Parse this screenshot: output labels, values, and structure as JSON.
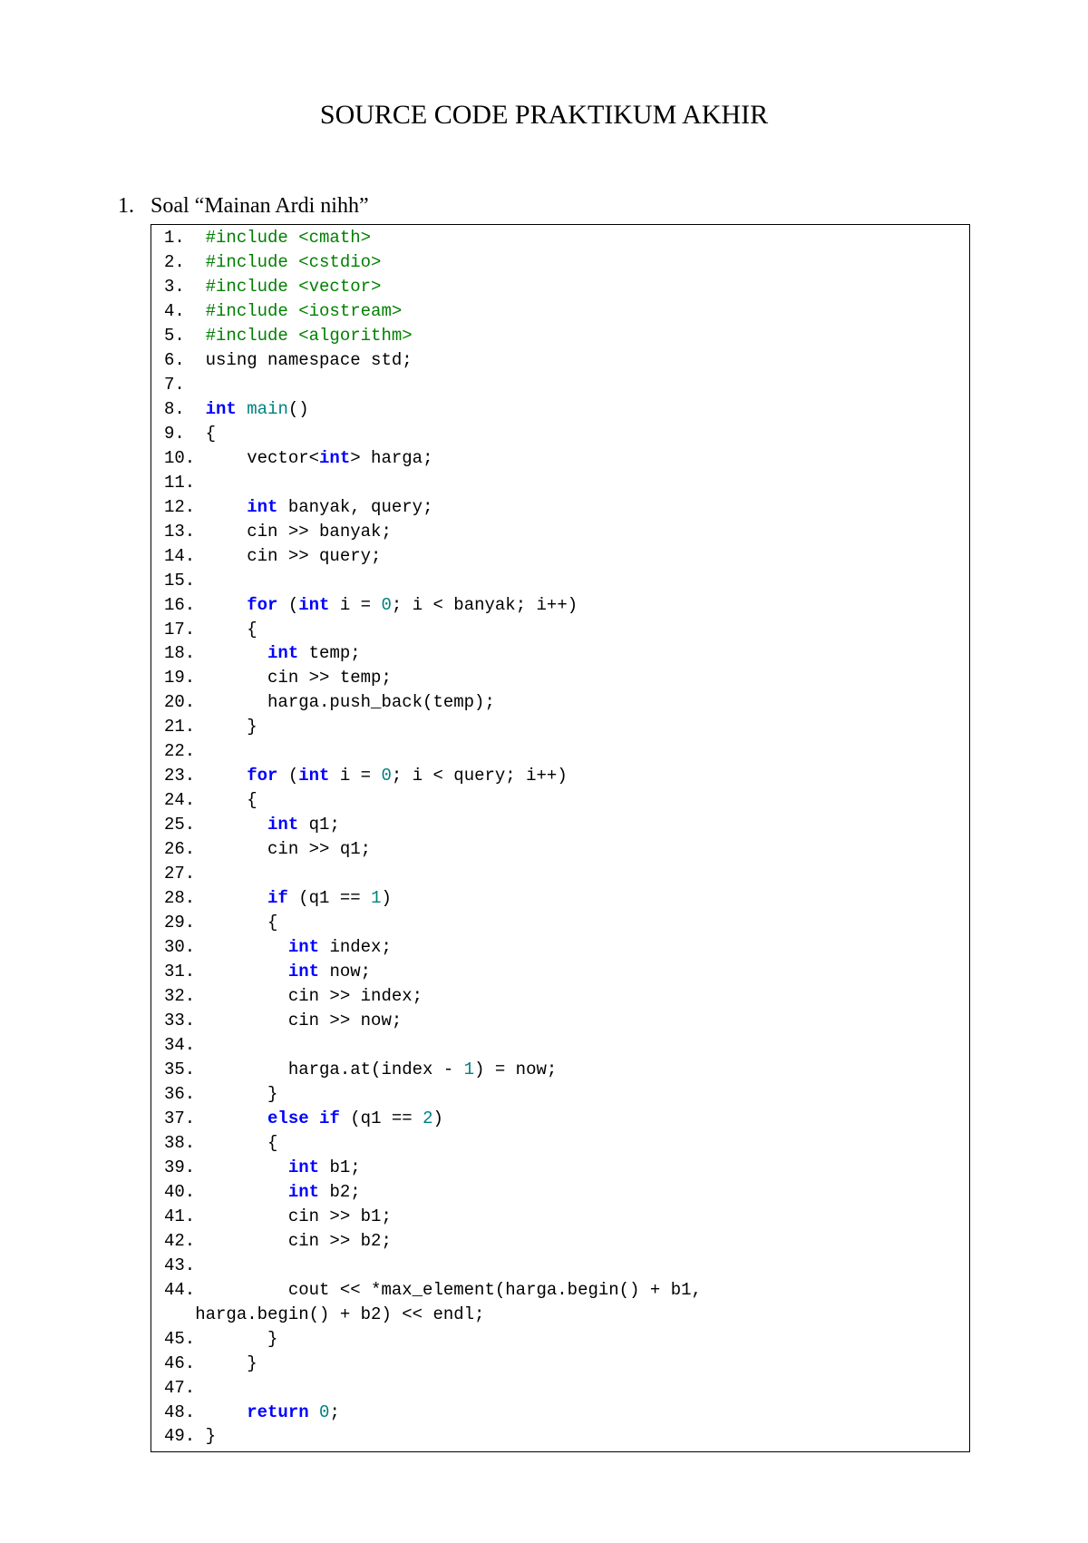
{
  "title": "SOURCE CODE PRAKTIKUM AKHIR",
  "section": {
    "number": "1.",
    "label": "Soal “Mainan Ardi nihh”"
  },
  "code": {
    "lines": [
      {
        "n": "1.",
        "tokens": [
          {
            "t": "pp",
            "v": "#include <cmath>"
          }
        ]
      },
      {
        "n": "2.",
        "tokens": [
          {
            "t": "pp",
            "v": "#include <cstdio>"
          }
        ]
      },
      {
        "n": "3.",
        "tokens": [
          {
            "t": "pp",
            "v": "#include <vector>"
          }
        ]
      },
      {
        "n": "4.",
        "tokens": [
          {
            "t": "pp",
            "v": "#include <iostream>"
          }
        ]
      },
      {
        "n": "5.",
        "tokens": [
          {
            "t": "pp",
            "v": "#include <algorithm>"
          }
        ]
      },
      {
        "n": "6.",
        "tokens": [
          {
            "t": "",
            "v": "using namespace std;"
          }
        ]
      },
      {
        "n": "7.",
        "tokens": []
      },
      {
        "n": "8.",
        "tokens": [
          {
            "t": "kw",
            "v": "int"
          },
          {
            "t": "",
            "v": " "
          },
          {
            "t": "fn",
            "v": "main"
          },
          {
            "t": "",
            "v": "()"
          }
        ]
      },
      {
        "n": "9.",
        "tokens": [
          {
            "t": "",
            "v": "{"
          }
        ]
      },
      {
        "n": "10.",
        "tokens": [
          {
            "t": "",
            "v": "    vector<"
          },
          {
            "t": "kw",
            "v": "int"
          },
          {
            "t": "",
            "v": "> harga;"
          }
        ]
      },
      {
        "n": "11.",
        "tokens": []
      },
      {
        "n": "12.",
        "tokens": [
          {
            "t": "",
            "v": "    "
          },
          {
            "t": "kw",
            "v": "int"
          },
          {
            "t": "",
            "v": " banyak, query;"
          }
        ]
      },
      {
        "n": "13.",
        "tokens": [
          {
            "t": "",
            "v": "    cin >> banyak;"
          }
        ]
      },
      {
        "n": "14.",
        "tokens": [
          {
            "t": "",
            "v": "    cin >> query;"
          }
        ]
      },
      {
        "n": "15.",
        "tokens": []
      },
      {
        "n": "16.",
        "tokens": [
          {
            "t": "",
            "v": "    "
          },
          {
            "t": "kw",
            "v": "for"
          },
          {
            "t": "",
            "v": " ("
          },
          {
            "t": "kw",
            "v": "int"
          },
          {
            "t": "",
            "v": " i = "
          },
          {
            "t": "num",
            "v": "0"
          },
          {
            "t": "",
            "v": "; i < banyak; i++)"
          }
        ]
      },
      {
        "n": "17.",
        "tokens": [
          {
            "t": "",
            "v": "    {"
          }
        ]
      },
      {
        "n": "18.",
        "tokens": [
          {
            "t": "",
            "v": "      "
          },
          {
            "t": "kw",
            "v": "int"
          },
          {
            "t": "",
            "v": " temp;"
          }
        ]
      },
      {
        "n": "19.",
        "tokens": [
          {
            "t": "",
            "v": "      cin >> temp;"
          }
        ]
      },
      {
        "n": "20.",
        "tokens": [
          {
            "t": "",
            "v": "      harga.push_back(temp);"
          }
        ]
      },
      {
        "n": "21.",
        "tokens": [
          {
            "t": "",
            "v": "    }"
          }
        ]
      },
      {
        "n": "22.",
        "tokens": []
      },
      {
        "n": "23.",
        "tokens": [
          {
            "t": "",
            "v": "    "
          },
          {
            "t": "kw",
            "v": "for"
          },
          {
            "t": "",
            "v": " ("
          },
          {
            "t": "kw",
            "v": "int"
          },
          {
            "t": "",
            "v": " i = "
          },
          {
            "t": "num",
            "v": "0"
          },
          {
            "t": "",
            "v": "; i < query; i++)"
          }
        ]
      },
      {
        "n": "24.",
        "tokens": [
          {
            "t": "",
            "v": "    {"
          }
        ]
      },
      {
        "n": "25.",
        "tokens": [
          {
            "t": "",
            "v": "      "
          },
          {
            "t": "kw",
            "v": "int"
          },
          {
            "t": "",
            "v": " q1;"
          }
        ]
      },
      {
        "n": "26.",
        "tokens": [
          {
            "t": "",
            "v": "      cin >> q1;"
          }
        ]
      },
      {
        "n": "27.",
        "tokens": []
      },
      {
        "n": "28.",
        "tokens": [
          {
            "t": "",
            "v": "      "
          },
          {
            "t": "kw",
            "v": "if"
          },
          {
            "t": "",
            "v": " (q1 == "
          },
          {
            "t": "num",
            "v": "1"
          },
          {
            "t": "",
            "v": ")"
          }
        ]
      },
      {
        "n": "29.",
        "tokens": [
          {
            "t": "",
            "v": "      {"
          }
        ]
      },
      {
        "n": "30.",
        "tokens": [
          {
            "t": "",
            "v": "        "
          },
          {
            "t": "kw",
            "v": "int"
          },
          {
            "t": "",
            "v": " index;"
          }
        ]
      },
      {
        "n": "31.",
        "tokens": [
          {
            "t": "",
            "v": "        "
          },
          {
            "t": "kw",
            "v": "int"
          },
          {
            "t": "",
            "v": " now;"
          }
        ]
      },
      {
        "n": "32.",
        "tokens": [
          {
            "t": "",
            "v": "        cin >> index;"
          }
        ]
      },
      {
        "n": "33.",
        "tokens": [
          {
            "t": "",
            "v": "        cin >> now;"
          }
        ]
      },
      {
        "n": "34.",
        "tokens": []
      },
      {
        "n": "35.",
        "tokens": [
          {
            "t": "",
            "v": "        harga.at(index - "
          },
          {
            "t": "num",
            "v": "1"
          },
          {
            "t": "",
            "v": ") = now;"
          }
        ]
      },
      {
        "n": "36.",
        "tokens": [
          {
            "t": "",
            "v": "      }"
          }
        ]
      },
      {
        "n": "37.",
        "tokens": [
          {
            "t": "",
            "v": "      "
          },
          {
            "t": "kw",
            "v": "else if"
          },
          {
            "t": "",
            "v": " (q1 == "
          },
          {
            "t": "num",
            "v": "2"
          },
          {
            "t": "",
            "v": ")"
          }
        ]
      },
      {
        "n": "38.",
        "tokens": [
          {
            "t": "",
            "v": "      {"
          }
        ]
      },
      {
        "n": "39.",
        "tokens": [
          {
            "t": "",
            "v": "        "
          },
          {
            "t": "kw",
            "v": "int"
          },
          {
            "t": "",
            "v": " b1;"
          }
        ]
      },
      {
        "n": "40.",
        "tokens": [
          {
            "t": "",
            "v": "        "
          },
          {
            "t": "kw",
            "v": "int"
          },
          {
            "t": "",
            "v": " b2;"
          }
        ]
      },
      {
        "n": "41.",
        "tokens": [
          {
            "t": "",
            "v": "        cin >> b1;"
          }
        ]
      },
      {
        "n": "42.",
        "tokens": [
          {
            "t": "",
            "v": "        cin >> b2;"
          }
        ]
      },
      {
        "n": "43.",
        "tokens": []
      },
      {
        "n": "44.",
        "tokens": [
          {
            "t": "",
            "v": "        cout << *max_element(harga.begin() + b1,"
          }
        ]
      },
      {
        "n": "",
        "tokens": [
          {
            "t": "",
            "v": "  harga.begin() + b2) << endl;"
          }
        ]
      },
      {
        "n": "45.",
        "tokens": [
          {
            "t": "",
            "v": "      }"
          }
        ]
      },
      {
        "n": "46.",
        "tokens": [
          {
            "t": "",
            "v": "    }"
          }
        ]
      },
      {
        "n": "47.",
        "tokens": []
      },
      {
        "n": "48.",
        "tokens": [
          {
            "t": "",
            "v": "    "
          },
          {
            "t": "kw",
            "v": "return"
          },
          {
            "t": "",
            "v": " "
          },
          {
            "t": "num",
            "v": "0"
          },
          {
            "t": "",
            "v": ";"
          }
        ]
      },
      {
        "n": "49.",
        "tokens": [
          {
            "t": "",
            "v": "}"
          }
        ]
      }
    ]
  }
}
